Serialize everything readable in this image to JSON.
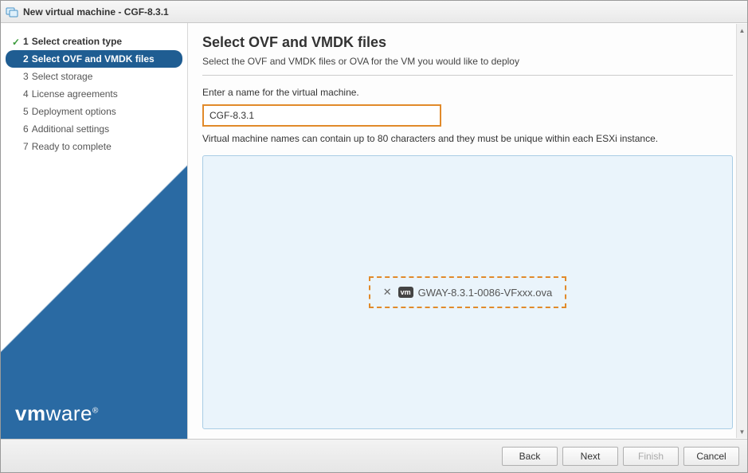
{
  "window": {
    "title": "New virtual machine - CGF-8.3.1"
  },
  "sidebar": {
    "steps": [
      {
        "num": "1",
        "label": "Select creation type",
        "state": "done"
      },
      {
        "num": "2",
        "label": "Select OVF and VMDK files",
        "state": "active"
      },
      {
        "num": "3",
        "label": "Select storage",
        "state": ""
      },
      {
        "num": "4",
        "label": "License agreements",
        "state": ""
      },
      {
        "num": "5",
        "label": "Deployment options",
        "state": ""
      },
      {
        "num": "6",
        "label": "Additional settings",
        "state": ""
      },
      {
        "num": "7",
        "label": "Ready to complete",
        "state": ""
      }
    ],
    "brand": "vmware"
  },
  "main": {
    "heading": "Select OVF and VMDK files",
    "subtitle": "Select the OVF and VMDK files or OVA for the VM you would like to deploy",
    "name_label": "Enter a name for the virtual machine.",
    "name_value": "CGF-8.3.1",
    "name_hint": "Virtual machine names can contain up to 80 characters and they must be unique within each ESXi instance.",
    "file": {
      "badge": "vm",
      "name": "GWAY-8.3.1-0086-VFxxx.ova"
    }
  },
  "footer": {
    "back": "Back",
    "next": "Next",
    "finish": "Finish",
    "cancel": "Cancel"
  }
}
